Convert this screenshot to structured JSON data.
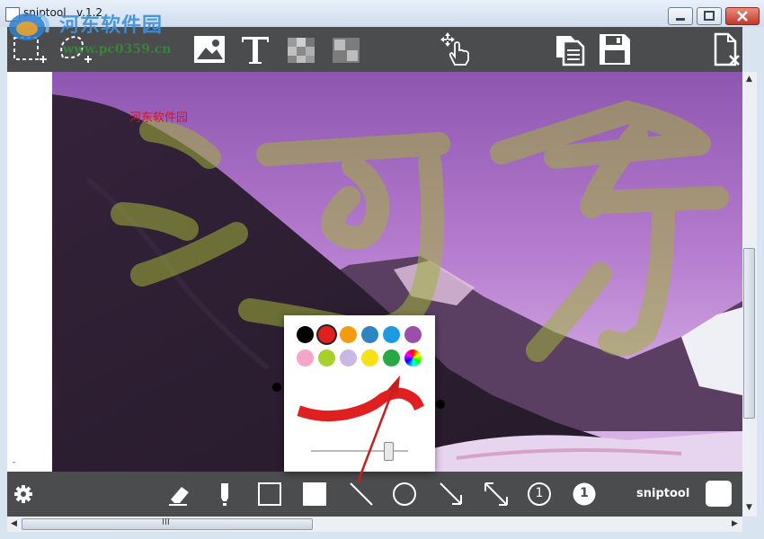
{
  "window": {
    "title": "sniptool   v.1.2",
    "watermark_site": "河东软件园",
    "watermark_url": "www.pc0359.cn"
  },
  "toolbar": {
    "icons": [
      "snip-rectangle-add-icon",
      "snip-freeform-add-icon",
      "image-icon",
      "text-icon",
      "pixelate-icon",
      "blur-icon",
      "move-hand-icon",
      "copy-icon",
      "save-icon",
      "close-file-icon"
    ]
  },
  "canvas": {
    "annotation_text": "河东软件园",
    "dash_text": "-"
  },
  "bottombar": {
    "tools": [
      "settings-icon",
      "eraser-icon",
      "marker-icon",
      "rectangle-outline-icon",
      "rectangle-filled-icon",
      "line-icon",
      "circle-icon",
      "arrow-icon",
      "double-arrow-icon",
      "number-outline-icon",
      "number-filled-icon"
    ],
    "number_outline_label": "1",
    "number_filled_label": "1",
    "brand": "sniptool",
    "current_color": "#ffffff"
  },
  "palette": {
    "colors": [
      "#000000",
      "#e02020",
      "#f39c12",
      "#2e86c1",
      "#1e9be0",
      "#9b4fa8",
      "#f5a6c8",
      "#a6d12c",
      "#c9b7e6",
      "#f7e017",
      "#27a845",
      "rainbow"
    ],
    "selected_index": 1,
    "stroke_color": "#e02020",
    "size_level": 0.8
  },
  "scrollbar": {
    "h_grip": "III"
  }
}
